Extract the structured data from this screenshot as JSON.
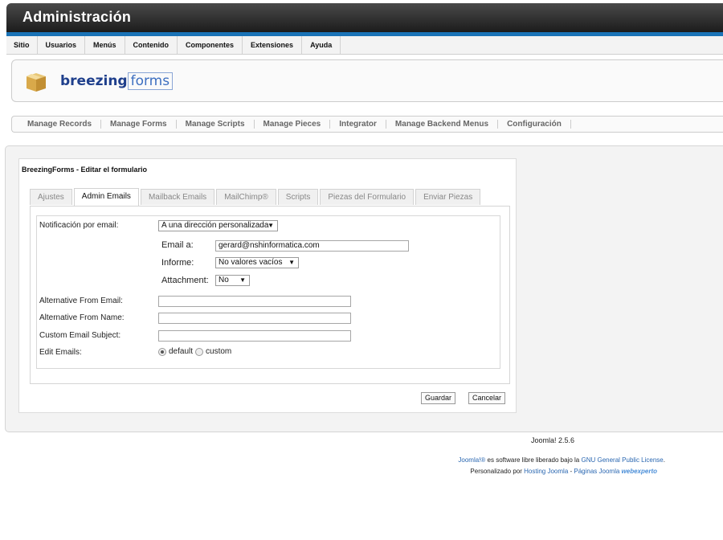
{
  "header": {
    "title": "Administración"
  },
  "menu": [
    "Sitio",
    "Usuarios",
    "Menús",
    "Contenido",
    "Componentes",
    "Extensiones",
    "Ayuda"
  ],
  "logo": {
    "part1": "breezing",
    "part2": "forms"
  },
  "submenu": [
    "Manage Records",
    "Manage Forms",
    "Manage Scripts",
    "Manage Pieces",
    "Integrator",
    "Manage Backend Menus",
    "Configuración"
  ],
  "form": {
    "title": "BreezingForms - Editar el formulario",
    "tabs": [
      "Ajustes",
      "Admin Emails",
      "Mailback Emails",
      "MailChimp®",
      "Scripts",
      "Piezas del Formulario",
      "Enviar Piezas"
    ],
    "active_tab": "Admin Emails",
    "fields": {
      "notif_label": "Notificación por email:",
      "notif_value": "A una dirección personalizada",
      "email_label": "Email a:",
      "email_value": "gerard@nshinformatica.com",
      "informe_label": "Informe:",
      "informe_value": "No valores vacíos",
      "attach_label": "Attachment:",
      "attach_value": "No",
      "alt_from_email_label": "Alternative From Email:",
      "alt_from_name_label": "Alternative From Name:",
      "custom_subject_label": "Custom Email Subject:",
      "edit_emails_label": "Edit Emails:",
      "edit_default": "default",
      "edit_custom": "custom"
    },
    "buttons": {
      "save": "Guardar",
      "cancel": "Cancelar"
    }
  },
  "footer": {
    "version": "Joomla! 2.5.6",
    "joomla_link": "Joomla!®",
    "text1": " es software libre liberado bajo la ",
    "license_link": "GNU General Public License",
    "text1_end": ".",
    "text2": "Personalizado por ",
    "hosting_link": "Hosting Joomla",
    "sep": " - ",
    "pages_link": "Páginas Joomla",
    "brand": "webexperto"
  }
}
